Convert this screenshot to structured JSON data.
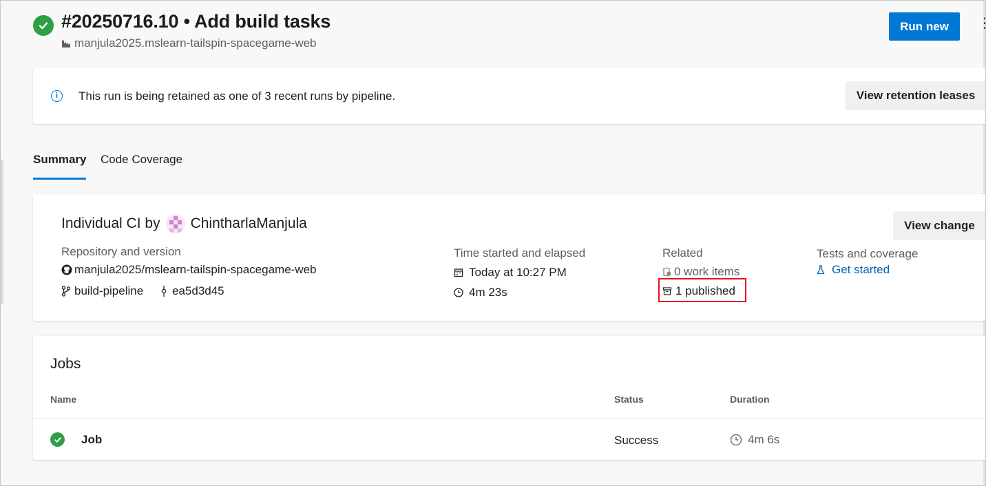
{
  "header": {
    "title": "#20250716.10 • Add build tasks",
    "repo": "manjula2025.mslearn-tailspin-spacegame-web",
    "run_new_label": "Run new",
    "more_label": "⋮"
  },
  "banner": {
    "message": "This run is being retained as one of 3 recent runs by pipeline.",
    "button_label": "View retention leases"
  },
  "tabs": [
    {
      "label": "Summary",
      "selected": true
    },
    {
      "label": "Code Coverage",
      "selected": false
    }
  ],
  "summary": {
    "trigger_prefix": "Individual CI by",
    "user_name": "ChintharlaManjula",
    "view_change_label": "View change",
    "repo_section": {
      "label": "Repository and version",
      "repo": "manjula2025/mslearn-tailspin-spacegame-web",
      "branch": "build-pipeline",
      "commit": "ea5d3d45"
    },
    "time_section": {
      "label": "Time started and elapsed",
      "started": "Today at 10:27 PM",
      "elapsed": "4m 23s"
    },
    "related_section": {
      "label": "Related",
      "work_items": "0 work items",
      "published": "1 published"
    },
    "tests_section": {
      "label": "Tests and coverage",
      "link": "Get started"
    }
  },
  "jobs": {
    "title": "Jobs",
    "columns": [
      "Name",
      "Status",
      "Duration"
    ],
    "rows": [
      {
        "name": "Job",
        "status": "Success",
        "duration": "4m 6s"
      }
    ]
  },
  "colors": {
    "accent": "#0078d4",
    "success": "#2f9e44",
    "highlight": "#e81123"
  }
}
